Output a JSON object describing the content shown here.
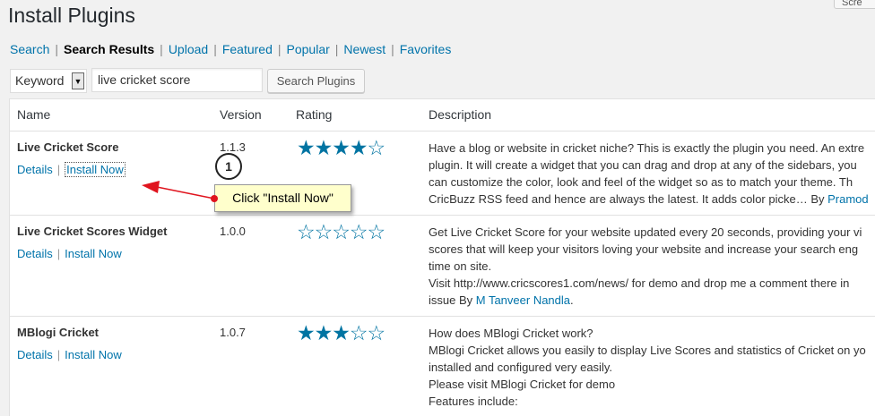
{
  "header": {
    "title": "Install Plugins",
    "top_right_button": "Scre"
  },
  "subnav": {
    "items": [
      {
        "label": "Search",
        "current": false
      },
      {
        "label": "Search Results",
        "current": true
      },
      {
        "label": "Upload",
        "current": false
      },
      {
        "label": "Featured",
        "current": false
      },
      {
        "label": "Popular",
        "current": false
      },
      {
        "label": "Newest",
        "current": false
      },
      {
        "label": "Favorites",
        "current": false
      }
    ],
    "separator": "|"
  },
  "search": {
    "type_selected": "Keyword",
    "query": "live cricket score",
    "button_label": "Search Plugins"
  },
  "table": {
    "columns": {
      "name": "Name",
      "version": "Version",
      "rating": "Rating",
      "description": "Description"
    },
    "rows": [
      {
        "name": "Live Cricket Score",
        "details": "Details",
        "install": "Install Now",
        "version": "1.1.3",
        "rating": 4,
        "desc": [
          "Have a blog or website in cricket niche? This is exactly the plugin you need. An extre",
          "plugin. It will create a widget that you can drag and drop at any of the sidebars, you",
          "can customize the color, look and feel of the widget so as to match your theme. Th",
          "CricBuzz RSS feed and hence are always the latest. It adds color picke…"
        ],
        "author_prefix": " By ",
        "author": "Pramod"
      },
      {
        "name": "Live Cricket Scores Widget",
        "details": "Details",
        "install": "Install Now",
        "version": "1.0.0",
        "rating": 0,
        "desc": [
          "Get Live Cricket Score for your website updated every 20 seconds, providing your vi",
          "scores that will keep your visitors loving your website and increase your search eng",
          "time on site.",
          "Visit http://www.cricscores1.com/news/ for demo and drop me a comment there in"
        ],
        "author_prefix": "issue By ",
        "author": "M Tanveer Nandla",
        "author_suffix": "."
      },
      {
        "name": "MBlogi Cricket",
        "details": "Details",
        "install": "Install Now",
        "version": "1.0.7",
        "rating": 3,
        "desc": [
          "How does MBlogi Cricket work?",
          "MBlogi Cricket allows you easily to display Live Scores and statistics of Cricket on yo",
          "installed and configured very easily.",
          "Please visit MBlogi Cricket for demo",
          "Features include:"
        ]
      }
    ]
  },
  "annotation": {
    "step": "1",
    "callout": "Click \"Install Now\""
  },
  "colors": {
    "link": "#0073aa",
    "star": "#0074a2",
    "callout_bg": "#ffffcc",
    "arrow": "#e0141e"
  }
}
